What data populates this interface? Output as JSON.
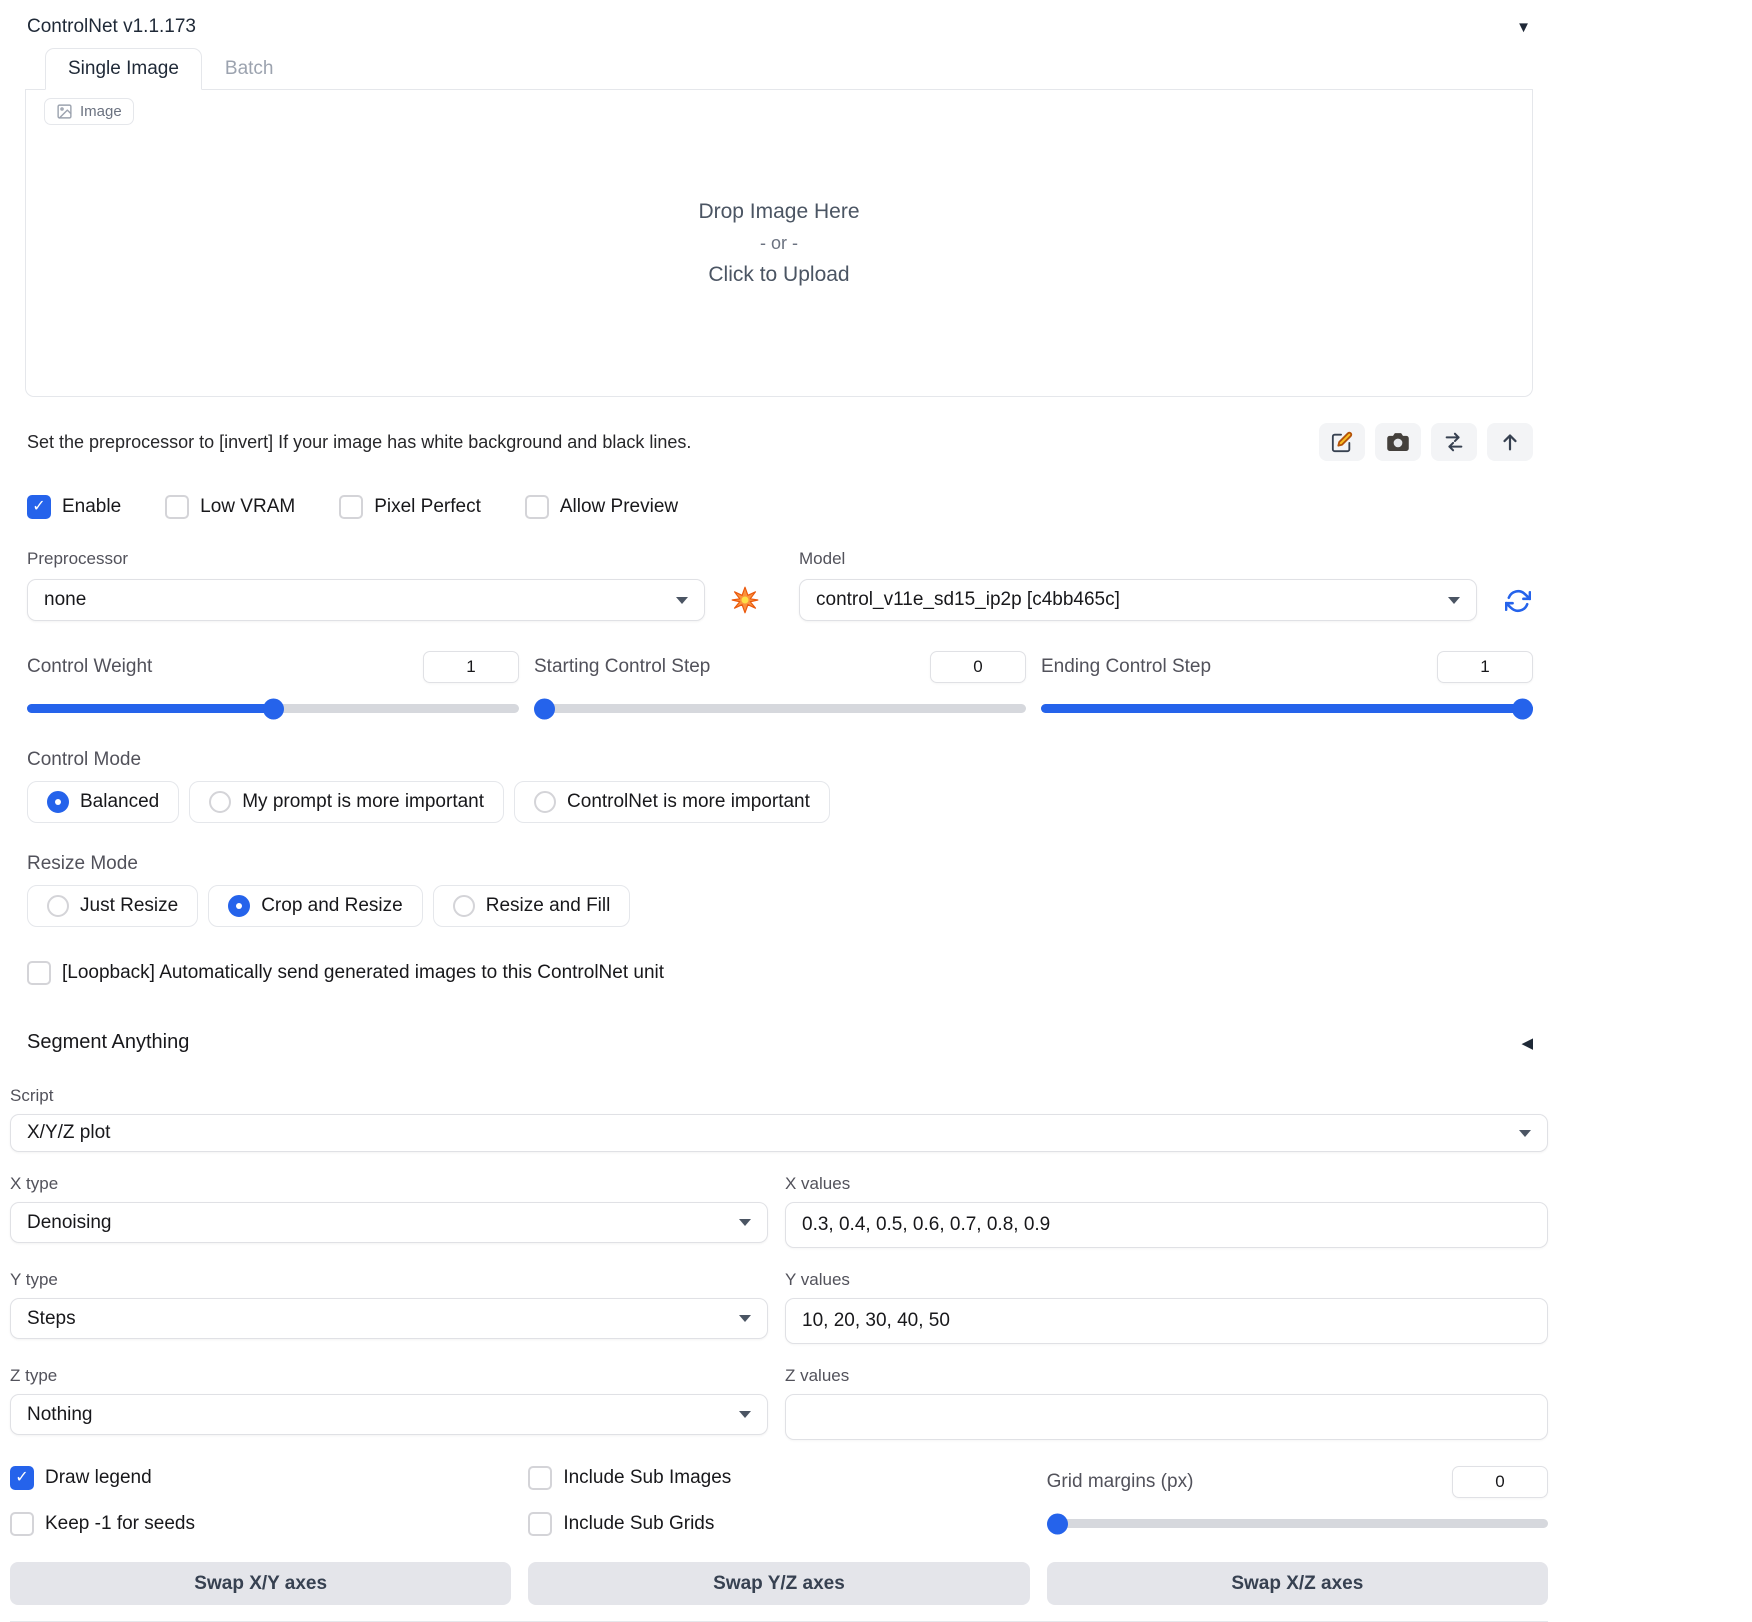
{
  "colors": {
    "accent_blue": "#2563eb",
    "explosion_orange": "#fb923c",
    "border_gray": "#e5e7eb"
  },
  "icons": {
    "panel_collapse": "▼",
    "accordion_collapse": "◀",
    "checkmark": "✓"
  },
  "panel": {
    "title": "ControlNet v1.1.173"
  },
  "tabs": [
    {
      "label": "Single Image",
      "active": true
    },
    {
      "label": "Batch",
      "active": false
    }
  ],
  "image_upload": {
    "label": "Image",
    "drop_line1": "Drop Image Here",
    "drop_line2": "- or -",
    "drop_line3": "Click to Upload"
  },
  "note": "Set the preprocessor to [invert] If your image has white background and black lines.",
  "options": [
    {
      "label": "Enable",
      "checked": true
    },
    {
      "label": "Low VRAM",
      "checked": false
    },
    {
      "label": "Pixel Perfect",
      "checked": false
    },
    {
      "label": "Allow Preview",
      "checked": false
    }
  ],
  "preprocessor": {
    "label": "Preprocessor",
    "value": "none"
  },
  "model": {
    "label": "Model",
    "value": "control_v11e_sd15_ip2p [c4bb465c]"
  },
  "sliders": {
    "control_weight": {
      "label": "Control Weight",
      "value": "1",
      "percent": 50
    },
    "starting_step": {
      "label": "Starting Control Step",
      "value": "0",
      "percent": 0
    },
    "ending_step": {
      "label": "Ending Control Step",
      "value": "1",
      "percent": 100
    }
  },
  "control_mode": {
    "label": "Control Mode",
    "options": [
      {
        "label": "Balanced",
        "selected": true
      },
      {
        "label": "My prompt is more important",
        "selected": false
      },
      {
        "label": "ControlNet is more important",
        "selected": false
      }
    ]
  },
  "resize_mode": {
    "label": "Resize Mode",
    "options": [
      {
        "label": "Just Resize",
        "selected": false
      },
      {
        "label": "Crop and Resize",
        "selected": true
      },
      {
        "label": "Resize and Fill",
        "selected": false
      }
    ]
  },
  "loopback": {
    "label": "[Loopback] Automatically send generated images to this ControlNet unit",
    "checked": false
  },
  "segment_anything": {
    "title": "Segment Anything"
  },
  "script": {
    "label": "Script",
    "value": "X/Y/Z plot"
  },
  "xyz": {
    "x_type": {
      "label": "X type",
      "value": "Denoising"
    },
    "x_values": {
      "label": "X values",
      "value": "0.3, 0.4, 0.5, 0.6, 0.7, 0.8, 0.9"
    },
    "y_type": {
      "label": "Y type",
      "value": "Steps"
    },
    "y_values": {
      "label": "Y values",
      "value": "10, 20, 30, 40, 50"
    },
    "z_type": {
      "label": "Z type",
      "value": "Nothing"
    },
    "z_values": {
      "label": "Z values",
      "value": ""
    }
  },
  "xyz_options": {
    "draw_legend": {
      "label": "Draw legend",
      "checked": true
    },
    "include_sub_images": {
      "label": "Include Sub Images",
      "checked": false
    },
    "keep_seeds": {
      "label": "Keep -1 for seeds",
      "checked": false
    },
    "include_sub_grids": {
      "label": "Include Sub Grids",
      "checked": false
    },
    "grid_margins": {
      "label": "Grid margins (px)",
      "value": "0",
      "percent": 0
    }
  },
  "swap_buttons": [
    {
      "label": "Swap X/Y axes"
    },
    {
      "label": "Swap Y/Z axes"
    },
    {
      "label": "Swap X/Z axes"
    }
  ]
}
